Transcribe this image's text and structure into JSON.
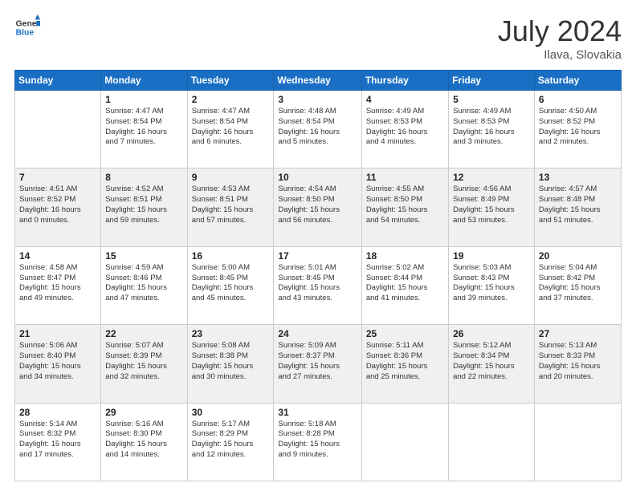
{
  "header": {
    "logo_line1": "General",
    "logo_line2": "Blue",
    "month_year": "July 2024",
    "location": "Ilava, Slovakia"
  },
  "days_of_week": [
    "Sunday",
    "Monday",
    "Tuesday",
    "Wednesday",
    "Thursday",
    "Friday",
    "Saturday"
  ],
  "weeks": [
    [
      {
        "day": "",
        "info": ""
      },
      {
        "day": "1",
        "info": "Sunrise: 4:47 AM\nSunset: 8:54 PM\nDaylight: 16 hours\nand 7 minutes."
      },
      {
        "day": "2",
        "info": "Sunrise: 4:47 AM\nSunset: 8:54 PM\nDaylight: 16 hours\nand 6 minutes."
      },
      {
        "day": "3",
        "info": "Sunrise: 4:48 AM\nSunset: 8:54 PM\nDaylight: 16 hours\nand 5 minutes."
      },
      {
        "day": "4",
        "info": "Sunrise: 4:49 AM\nSunset: 8:53 PM\nDaylight: 16 hours\nand 4 minutes."
      },
      {
        "day": "5",
        "info": "Sunrise: 4:49 AM\nSunset: 8:53 PM\nDaylight: 16 hours\nand 3 minutes."
      },
      {
        "day": "6",
        "info": "Sunrise: 4:50 AM\nSunset: 8:52 PM\nDaylight: 16 hours\nand 2 minutes."
      }
    ],
    [
      {
        "day": "7",
        "info": "Sunrise: 4:51 AM\nSunset: 8:52 PM\nDaylight: 16 hours\nand 0 minutes."
      },
      {
        "day": "8",
        "info": "Sunrise: 4:52 AM\nSunset: 8:51 PM\nDaylight: 15 hours\nand 59 minutes."
      },
      {
        "day": "9",
        "info": "Sunrise: 4:53 AM\nSunset: 8:51 PM\nDaylight: 15 hours\nand 57 minutes."
      },
      {
        "day": "10",
        "info": "Sunrise: 4:54 AM\nSunset: 8:50 PM\nDaylight: 15 hours\nand 56 minutes."
      },
      {
        "day": "11",
        "info": "Sunrise: 4:55 AM\nSunset: 8:50 PM\nDaylight: 15 hours\nand 54 minutes."
      },
      {
        "day": "12",
        "info": "Sunrise: 4:56 AM\nSunset: 8:49 PM\nDaylight: 15 hours\nand 53 minutes."
      },
      {
        "day": "13",
        "info": "Sunrise: 4:57 AM\nSunset: 8:48 PM\nDaylight: 15 hours\nand 51 minutes."
      }
    ],
    [
      {
        "day": "14",
        "info": "Sunrise: 4:58 AM\nSunset: 8:47 PM\nDaylight: 15 hours\nand 49 minutes."
      },
      {
        "day": "15",
        "info": "Sunrise: 4:59 AM\nSunset: 8:46 PM\nDaylight: 15 hours\nand 47 minutes."
      },
      {
        "day": "16",
        "info": "Sunrise: 5:00 AM\nSunset: 8:45 PM\nDaylight: 15 hours\nand 45 minutes."
      },
      {
        "day": "17",
        "info": "Sunrise: 5:01 AM\nSunset: 8:45 PM\nDaylight: 15 hours\nand 43 minutes."
      },
      {
        "day": "18",
        "info": "Sunrise: 5:02 AM\nSunset: 8:44 PM\nDaylight: 15 hours\nand 41 minutes."
      },
      {
        "day": "19",
        "info": "Sunrise: 5:03 AM\nSunset: 8:43 PM\nDaylight: 15 hours\nand 39 minutes."
      },
      {
        "day": "20",
        "info": "Sunrise: 5:04 AM\nSunset: 8:42 PM\nDaylight: 15 hours\nand 37 minutes."
      }
    ],
    [
      {
        "day": "21",
        "info": "Sunrise: 5:06 AM\nSunset: 8:40 PM\nDaylight: 15 hours\nand 34 minutes."
      },
      {
        "day": "22",
        "info": "Sunrise: 5:07 AM\nSunset: 8:39 PM\nDaylight: 15 hours\nand 32 minutes."
      },
      {
        "day": "23",
        "info": "Sunrise: 5:08 AM\nSunset: 8:38 PM\nDaylight: 15 hours\nand 30 minutes."
      },
      {
        "day": "24",
        "info": "Sunrise: 5:09 AM\nSunset: 8:37 PM\nDaylight: 15 hours\nand 27 minutes."
      },
      {
        "day": "25",
        "info": "Sunrise: 5:11 AM\nSunset: 8:36 PM\nDaylight: 15 hours\nand 25 minutes."
      },
      {
        "day": "26",
        "info": "Sunrise: 5:12 AM\nSunset: 8:34 PM\nDaylight: 15 hours\nand 22 minutes."
      },
      {
        "day": "27",
        "info": "Sunrise: 5:13 AM\nSunset: 8:33 PM\nDaylight: 15 hours\nand 20 minutes."
      }
    ],
    [
      {
        "day": "28",
        "info": "Sunrise: 5:14 AM\nSunset: 8:32 PM\nDaylight: 15 hours\nand 17 minutes."
      },
      {
        "day": "29",
        "info": "Sunrise: 5:16 AM\nSunset: 8:30 PM\nDaylight: 15 hours\nand 14 minutes."
      },
      {
        "day": "30",
        "info": "Sunrise: 5:17 AM\nSunset: 8:29 PM\nDaylight: 15 hours\nand 12 minutes."
      },
      {
        "day": "31",
        "info": "Sunrise: 5:18 AM\nSunset: 8:28 PM\nDaylight: 15 hours\nand 9 minutes."
      },
      {
        "day": "",
        "info": ""
      },
      {
        "day": "",
        "info": ""
      },
      {
        "day": "",
        "info": ""
      }
    ]
  ]
}
